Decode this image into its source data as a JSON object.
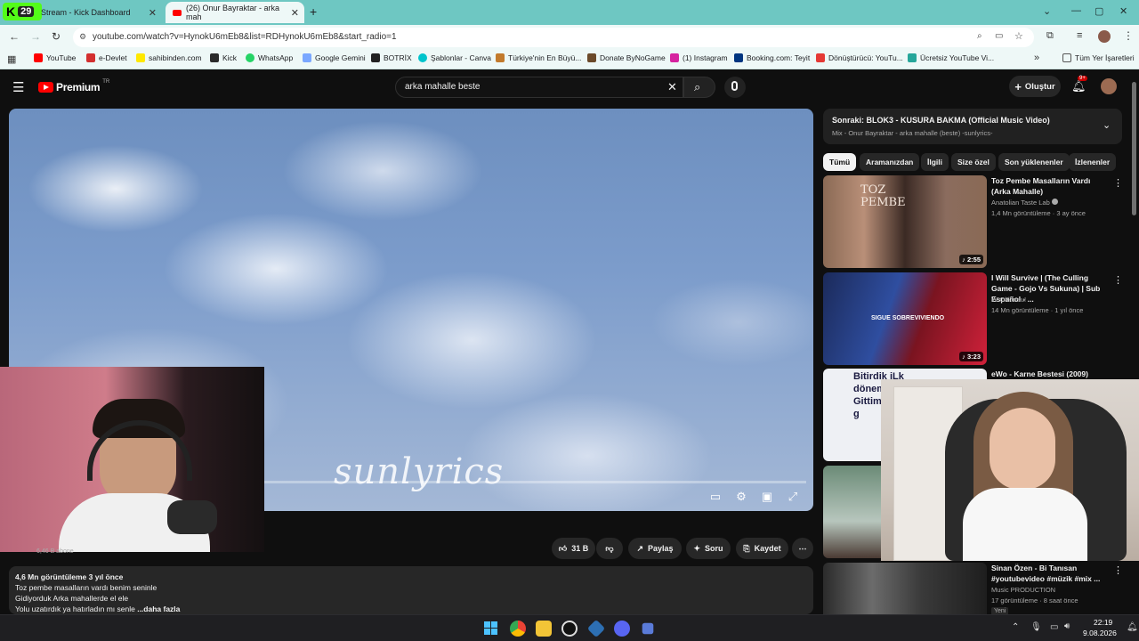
{
  "browser": {
    "tabs": [
      {
        "label": "Stream - Kick Dashboard"
      },
      {
        "label": "(26) Onur Bayraktar - arka mah"
      }
    ],
    "kick_badge": "29",
    "url": "youtube.com/watch?v=HynokU6mEb8&list=RDHynokU6mEb8&start_radio=1",
    "bookmarks": [
      "YouTube",
      "e-Devlet",
      "sahibinden.com",
      "Kick",
      "WhatsApp",
      "Google Gemini",
      "BOTRİX",
      "Şablonlar - Canva",
      "Türkiye'nin En Büyü...",
      "Donate ByNoGame",
      "(1) Instagram",
      "Booking.com: Teyit",
      "Dönüştürücü: YouTu...",
      "Ücretsiz YouTube Vi..."
    ],
    "bookmarks_all": "Tüm Yer İşaretleri"
  },
  "youtube": {
    "logo": "Premium",
    "logo_country": "TR",
    "search_value": "arka mahalle beste",
    "create_label": "Oluştur",
    "notif_count": "9+"
  },
  "player": {
    "watermark": "sunlyrics"
  },
  "below_video": {
    "subscribers": "6,46 B abone",
    "like_count": "31 B",
    "share": "Paylaş",
    "ask": "Soru",
    "save": "Kaydet",
    "desc_stats": "4,6 Mn görüntüleme  3 yıl önce",
    "desc_lines": [
      "Toz pembe masalların vardı benim seninle",
      "Gidiyorduk Arka mahallerde el ele",
      "Yolu uzatırdık ya hatırladın mı senle"
    ],
    "desc_more": "...daha fazla"
  },
  "sidebar": {
    "next_title": "Sonraki: BLOK3 - KUSURA BAKMA (Official Music Video)",
    "next_sub": "Mix - Onur Bayraktar - arka mahalle (beste) -sunlyrics-",
    "chips": [
      "Tümü",
      "Aramanızdan",
      "İlgili",
      "Size özel",
      "Son yüklenenler",
      "İzlenenler"
    ],
    "recs": [
      {
        "title": "Toz Pembe Masalların Vardı (Arka Mahalle)",
        "channel": "Anatolian Taste Lab",
        "meta": "1,4 Mn görüntüleme · 3 ay önce",
        "duration": "2:55",
        "thumb_text": "TOZ PEMBE"
      },
      {
        "title": "I Will Survive | (The Culling Game - Gojo Vs Sukuna) | Sub Español - ...",
        "channel": "W-Okkotsu!",
        "meta": "14 Mn görüntüleme · 1 yıl önce",
        "duration": "3:23",
        "thumb_text": "SIGUE SOBREVIVIENDO"
      },
      {
        "title": "eWo - Karne Bestesi (2009)",
        "thumb_text": "Bitirdik iLk dönemi Gittim Zayıf g"
      },
      {
        "title": "Sinan Özen - Bi Tanısan #youtubevideo #müzik #mix ...",
        "channel": "Music PRODUCTION",
        "meta": "17 görüntüleme · 8 saat önce",
        "badge": "Yeni"
      }
    ]
  },
  "taskbar": {
    "time": "22:19",
    "date": "9.08.2026"
  }
}
